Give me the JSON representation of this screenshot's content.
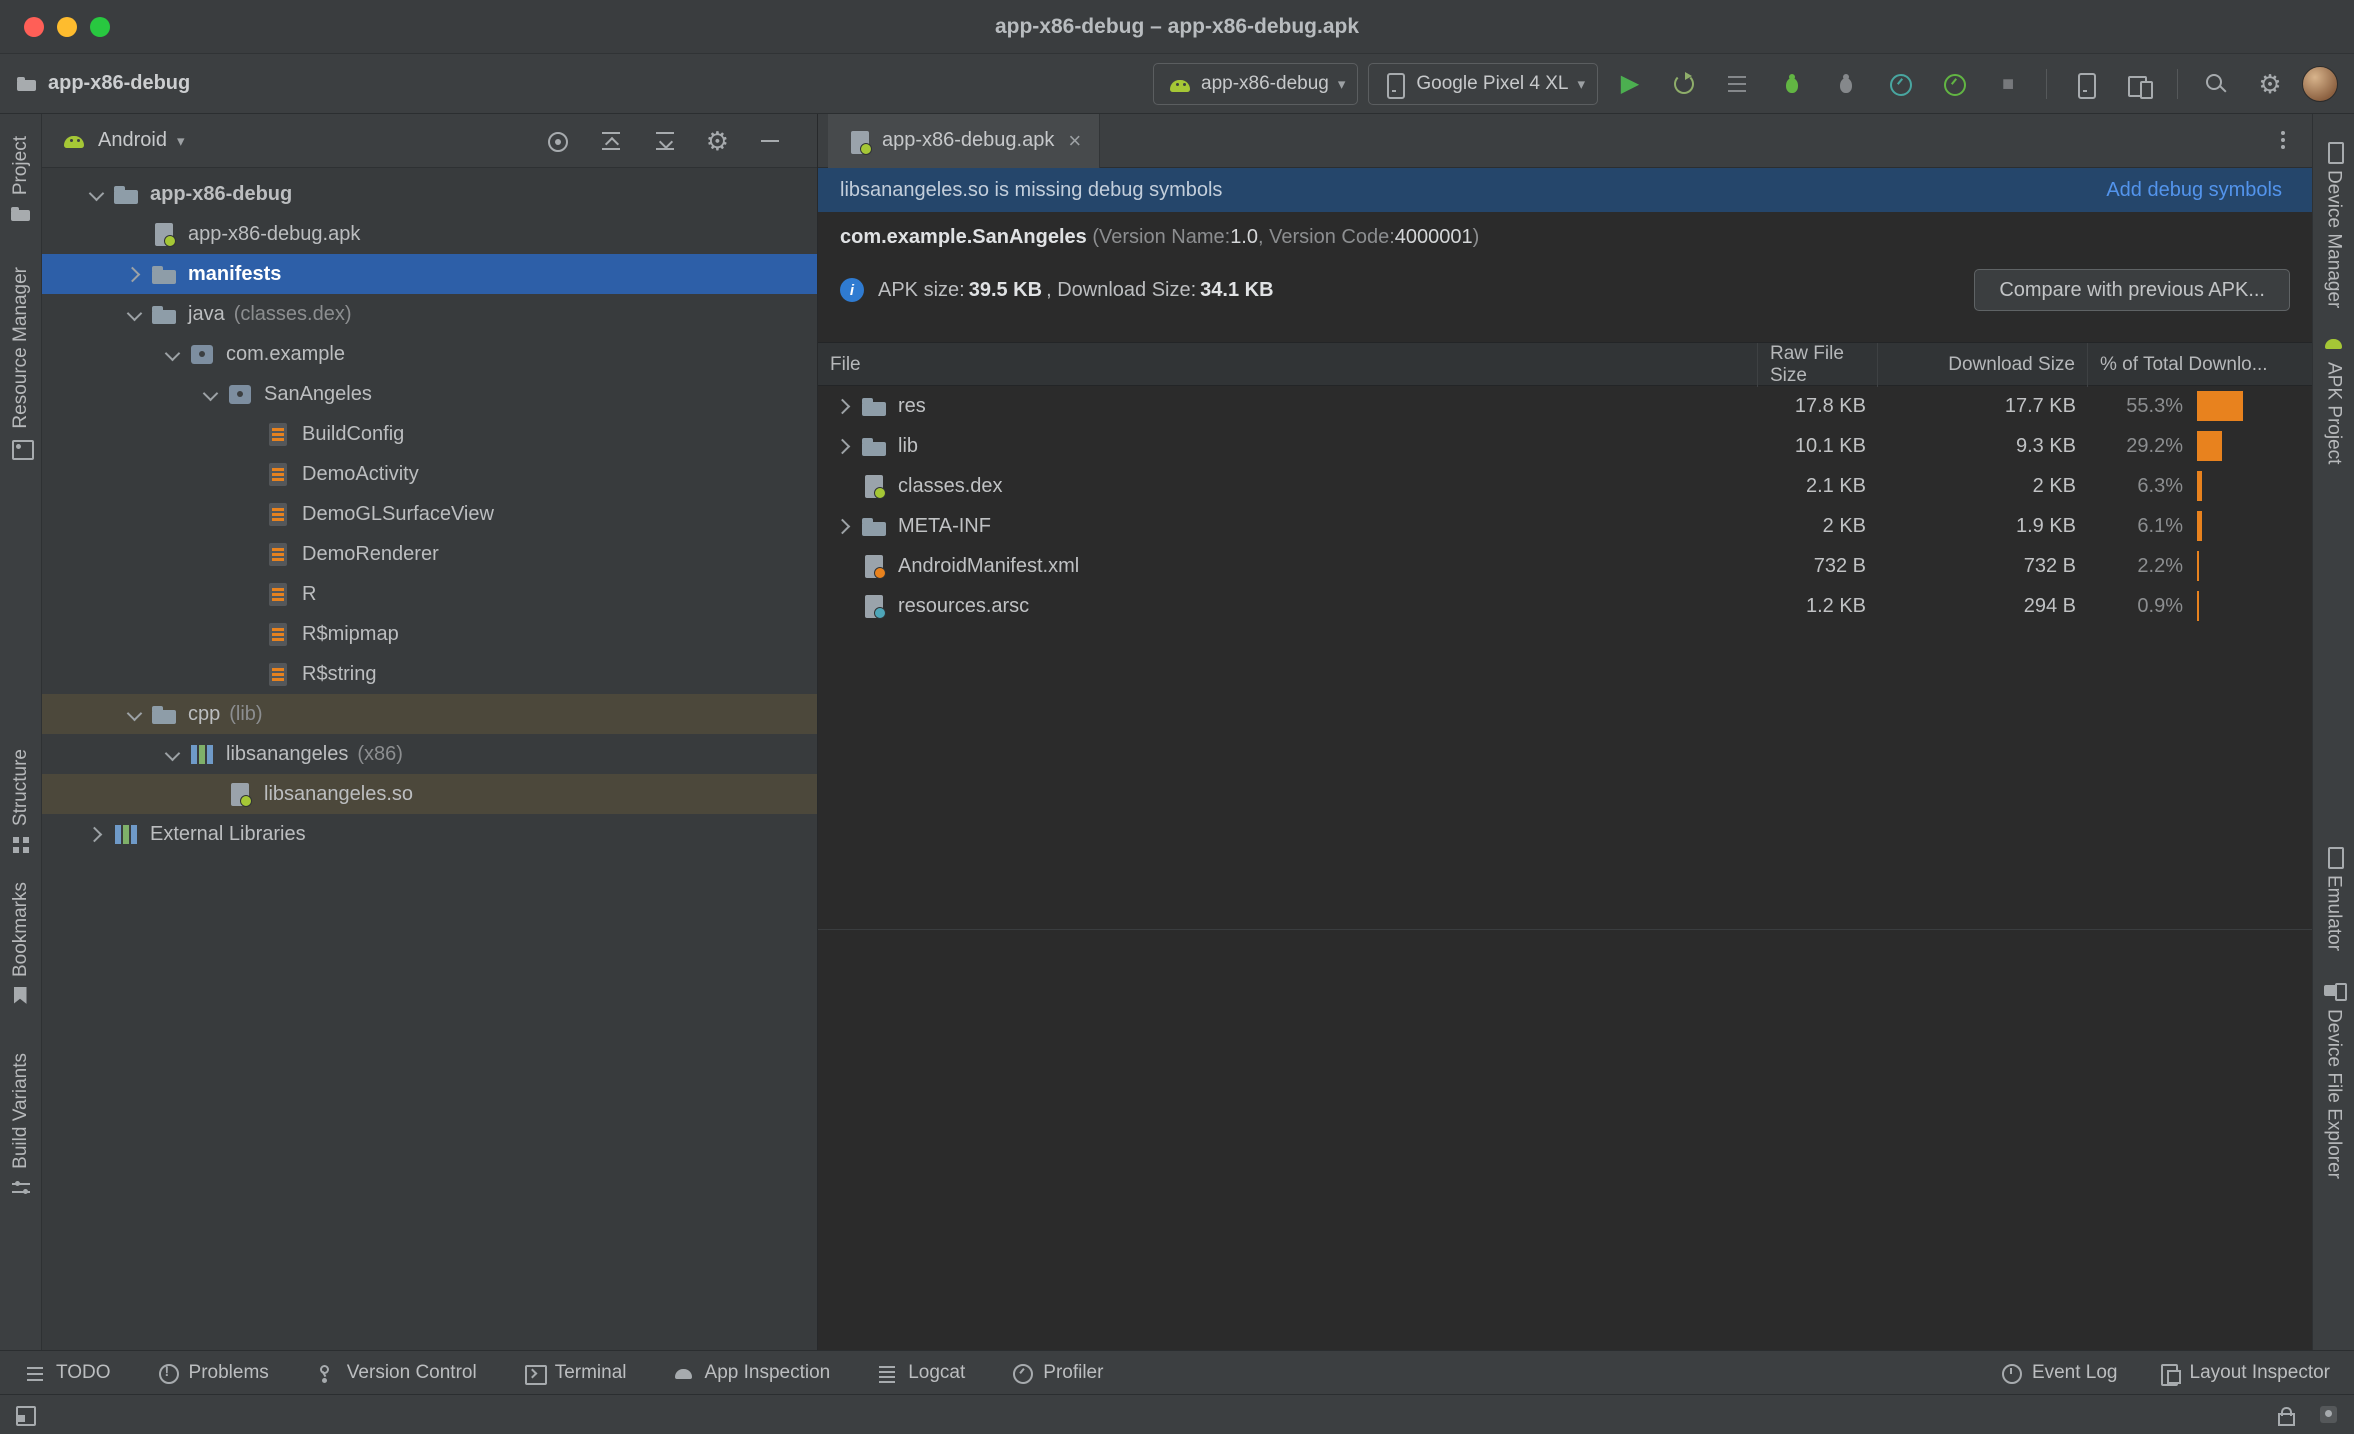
{
  "window": {
    "title": "app-x86-debug – app-x86-debug.apk"
  },
  "toolbar": {
    "project_name": "app-x86-debug",
    "run_config": "app-x86-debug",
    "device": "Google Pixel 4 XL"
  },
  "left_stripe": {
    "items": [
      {
        "label": "Project"
      },
      {
        "label": "Resource Manager"
      },
      {
        "label": "Structure"
      },
      {
        "label": "Bookmarks"
      },
      {
        "label": "Build Variants"
      }
    ]
  },
  "right_stripe": {
    "items": [
      {
        "label": "Device Manager"
      },
      {
        "label": "APK Project"
      },
      {
        "label": "Emulator"
      },
      {
        "label": "Device File Explorer"
      }
    ]
  },
  "project_panel": {
    "view_selector": "Android",
    "items": [
      {
        "label": "app-x86-debug"
      },
      {
        "label": "app-x86-debug.apk"
      },
      {
        "label": "manifests"
      },
      {
        "label": "java",
        "suffix": "(classes.dex)"
      },
      {
        "label": "com.example"
      },
      {
        "label": "SanAngeles"
      },
      {
        "label": "BuildConfig"
      },
      {
        "label": "DemoActivity"
      },
      {
        "label": "DemoGLSurfaceView"
      },
      {
        "label": "DemoRenderer"
      },
      {
        "label": "R"
      },
      {
        "label": "R$mipmap"
      },
      {
        "label": "R$string"
      },
      {
        "label": "cpp",
        "suffix": "(lib)"
      },
      {
        "label": "libsanangeles",
        "suffix": "(x86)"
      },
      {
        "label": "libsanangeles.so"
      },
      {
        "label": "External Libraries"
      }
    ]
  },
  "editor": {
    "tab_label": "app-x86-debug.apk",
    "banner": {
      "message": "libsanangeles.so is missing debug symbols",
      "action": "Add debug symbols"
    },
    "apk_header": {
      "package": "com.example.SanAngeles",
      "version_prefix": "(Version Name: ",
      "version_name": "1.0",
      "version_mid": ", Version Code: ",
      "version_code": "4000001",
      "version_suffix": ")",
      "size_prefix": "APK size: ",
      "apk_size": "39.5 KB",
      "size_mid": ", Download Size: ",
      "download_size": "34.1 KB",
      "compare_button": "Compare with previous APK..."
    },
    "table": {
      "columns": {
        "file": "File",
        "raw": "Raw File Size",
        "download": "Download Size",
        "pct": "% of Total Downlo..."
      },
      "rows": [
        {
          "file": "res",
          "raw": "17.8 KB",
          "download": "17.7 KB",
          "pct": "55.3%",
          "pct_value": 55.3
        },
        {
          "file": "lib",
          "raw": "10.1 KB",
          "download": "9.3 KB",
          "pct": "29.2%",
          "pct_value": 29.2
        },
        {
          "file": "classes.dex",
          "raw": "2.1 KB",
          "download": "2 KB",
          "pct": "6.3%",
          "pct_value": 6.3
        },
        {
          "file": "META-INF",
          "raw": "2 KB",
          "download": "1.9 KB",
          "pct": "6.1%",
          "pct_value": 6.1
        },
        {
          "file": "AndroidManifest.xml",
          "raw": "732 B",
          "download": "732 B",
          "pct": "2.2%",
          "pct_value": 2.2
        },
        {
          "file": "resources.arsc",
          "raw": "1.2 KB",
          "download": "294 B",
          "pct": "0.9%",
          "pct_value": 0.9
        }
      ]
    }
  },
  "bottom_bar": {
    "left": [
      {
        "label": "TODO"
      },
      {
        "label": "Problems"
      },
      {
        "label": "Version Control"
      },
      {
        "label": "Terminal"
      },
      {
        "label": "App Inspection"
      },
      {
        "label": "Logcat"
      },
      {
        "label": "Profiler"
      }
    ],
    "right": [
      {
        "label": "Event Log"
      },
      {
        "label": "Layout Inspector"
      }
    ]
  },
  "colors": {
    "selection_blue": "#2d5fa8",
    "selection_olive": "#4c483b",
    "size_bar_orange": "#e8821e",
    "link_blue": "#5394ec",
    "android_green": "#a5c736",
    "run_green": "#4caf50",
    "banner_blue": "#25466b"
  },
  "icons": {
    "search-icon": "magnifier",
    "settings-gear-icon": "⚙",
    "run-icon": "green play ▶",
    "stop-icon": "gray square ■",
    "debug-icon": "green bug",
    "profiler-icon": "teal gauge",
    "android-icon": "green robot head",
    "folder-icon": "gray-blue folder",
    "apk-file-icon": "file with green android dot",
    "class-icon": "file with orange stripes",
    "close-icon": "×",
    "kebab-menu-icon": "vertical dots"
  }
}
